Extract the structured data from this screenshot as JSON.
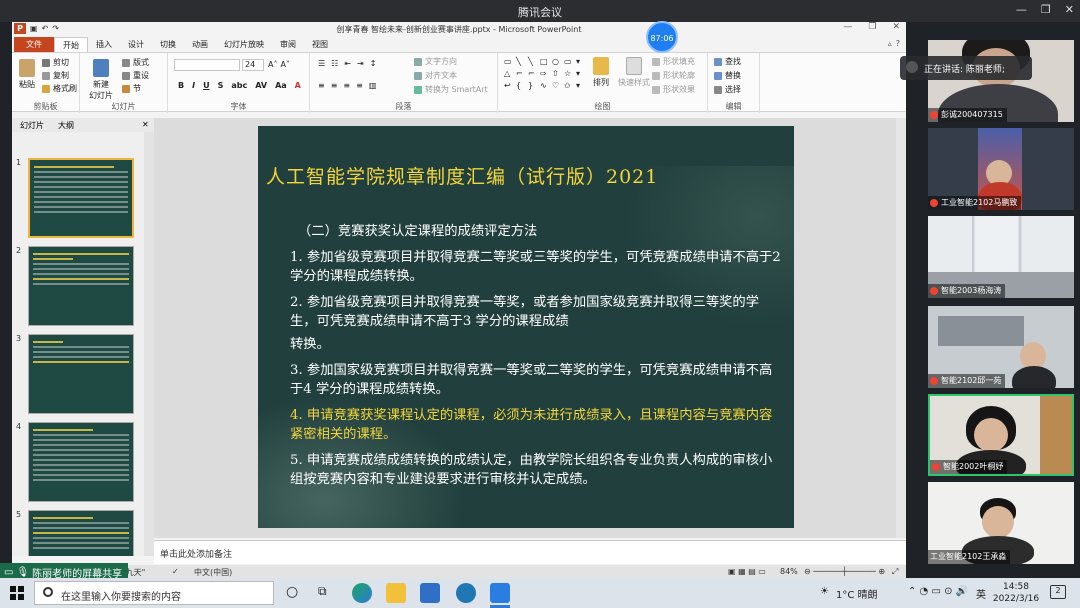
{
  "meeting": {
    "app_title": "腾讯会议",
    "speaking_label": "正在讲话: 陈丽老师;",
    "share_label": "陈丽老师的屏幕共享",
    "timer": "87:06"
  },
  "ppt": {
    "document_title": "创享青春 智绘未来-创新创业赛事讲座.pptx - Microsoft PowerPoint",
    "tabs": [
      "文件",
      "开始",
      "插入",
      "设计",
      "切换",
      "动画",
      "幻灯片放映",
      "审阅",
      "视图"
    ],
    "active_tab": "开始",
    "ribbon": {
      "paste": "粘贴",
      "cut": "剪切",
      "copy": "复制",
      "format_painter": "格式刷",
      "clipboard_label": "剪贴板",
      "new_slide": "新建\n幻灯片",
      "layout": "版式",
      "reset": "重设",
      "section": "节",
      "slides_label": "幻灯片",
      "font_size": "24",
      "font_label": "字体",
      "text_direction": "文字方向",
      "align_text": "对齐文本",
      "smartart": "转换为 SmartArt",
      "paragraph_label": "段落",
      "arrange": "排列",
      "quick_styles": "快速样式",
      "shape_fill": "形状填充",
      "shape_outline": "形状轮廓",
      "shape_effects": "形状效果",
      "drawing_label": "绘图",
      "find": "查找",
      "replace": "替换",
      "select": "选择",
      "editing_label": "编辑"
    },
    "pane_tabs": [
      "幻灯片",
      "大纲"
    ],
    "thumbnails": [
      "1",
      "2",
      "3",
      "4",
      "5"
    ],
    "notes_placeholder": "单击此处添加备注",
    "status": {
      "theme": "\"凤舞九天\"",
      "language": "中文(中国)",
      "zoom": "84%"
    },
    "slide": {
      "title": "人工智能学院规章制度汇编（试行版）2021",
      "subtitle": "（二）竞赛获奖认定课程的成绩评定方法",
      "p1": "1. 参加省级竞赛项目并取得竞赛二等奖或三等奖的学生，可凭竞赛成绩申请不高于2 学分的课程成绩转换。",
      "p2": "2. 参加省级竞赛项目并取得竞赛一等奖，或者参加国家级竞赛并取得三等奖的学生，可凭竞赛成绩申请不高于3 学分的课程成绩",
      "p2b": "转换。",
      "p3": "3. 参加国家级竞赛项目并取得竞赛一等奖或二等奖的学生，可凭竞赛成绩申请不高于4 学分的课程成绩转换。",
      "p4": "4. 申请竞赛获奖课程认定的课程，必须为未进行成绩录入，且课程内容与竞赛内容紧密相关的课程。",
      "p5": "5. 申请竞赛成绩成绩转换的成绩认定，由教学院长组织各专业负责人构成的审核小组按竞赛内容和专业建设要求进行审核并认定成绩。"
    }
  },
  "participants": [
    {
      "name": "彭诚200407315"
    },
    {
      "name": "工业智能2102马鹏致"
    },
    {
      "name": "智能2003杨海涛"
    },
    {
      "name": "智能2102邱一苑"
    },
    {
      "name": "智能2002叶桐妤"
    },
    {
      "name": "工业智能2102王承淼"
    }
  ],
  "taskbar": {
    "search_placeholder": "在这里输入你要搜索的内容",
    "weather": "1°C 晴朗",
    "ime": "英",
    "time": "14:58",
    "date": "2022/3/16",
    "notifications": "2"
  }
}
